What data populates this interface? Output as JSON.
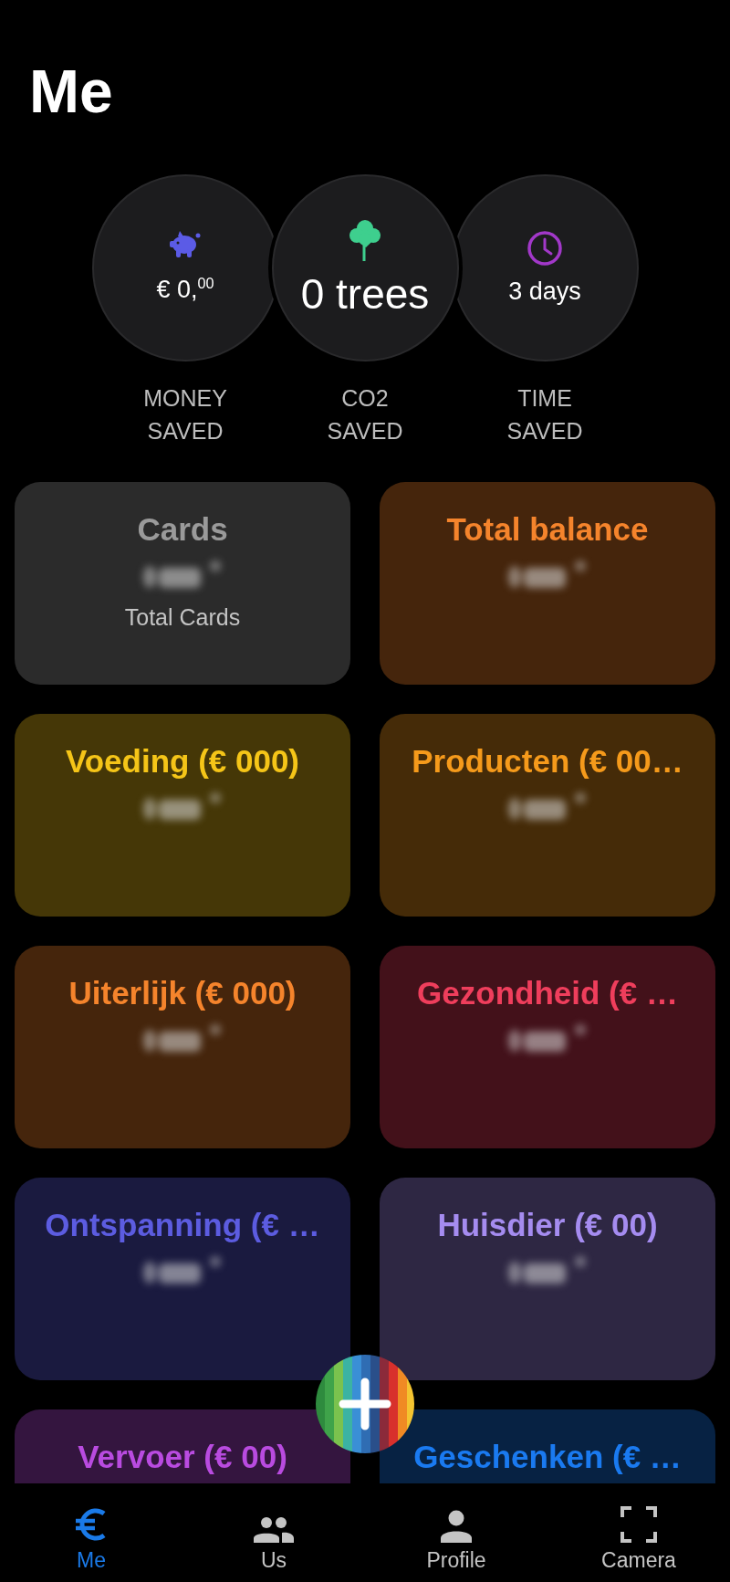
{
  "title": "Me",
  "stats": [
    {
      "value": "€ 0,$^{00}$",
      "large": false,
      "label": "MONEY SAVED"
    },
    {
      "value": "0 trees",
      "large": true,
      "label": "CO2 SAVED"
    },
    {
      "value": "3 days",
      "large": false,
      "label": "TIME SAVED"
    }
  ],
  "cards": [
    {
      "title": "Cards",
      "color": "#9a9a9a",
      "subtitle": "Total Cards"
    },
    {
      "title": "Total balance",
      "color": "#f5842c"
    },
    {
      "title": "Voeding (€ 000)",
      "color": "#f5c518"
    },
    {
      "title": "Producten (€ 00…",
      "color": "#f59a1b"
    },
    {
      "title": "Uiterlijk (€ 000)",
      "color": "#f5842c"
    },
    {
      "title": "Gezondheid (€ …",
      "color": "#ef3e5c"
    },
    {
      "title": "Ontspanning (€ …",
      "color": "#5c5ce0"
    },
    {
      "title": "Huisdier (€ 00)",
      "color": "#a58cf0"
    },
    {
      "title": "Vervoer (€ 00)",
      "color": "#b94be0"
    },
    {
      "title": "Geschenken (€ …",
      "color": "#1a7af0"
    }
  ],
  "nav": [
    {
      "label": "Me",
      "selected": true
    },
    {
      "label": "Us",
      "selected": false
    },
    {
      "label": "Profile",
      "selected": false
    },
    {
      "label": "Camera",
      "selected": false
    }
  ]
}
